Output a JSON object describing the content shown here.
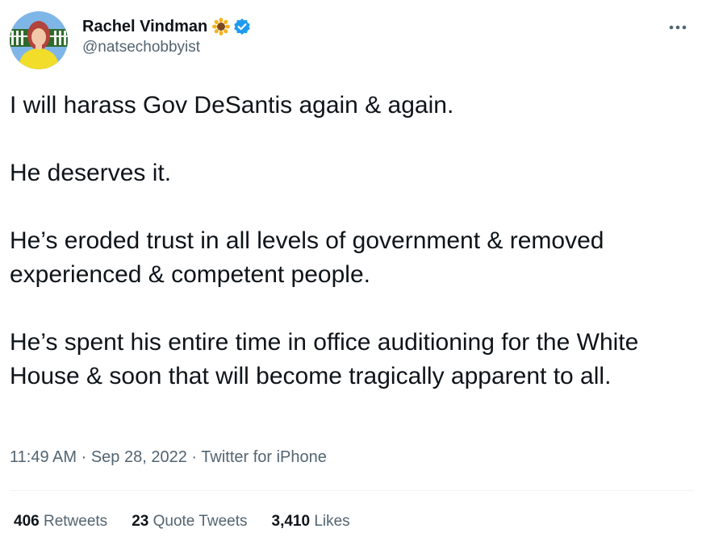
{
  "author": {
    "display_name": "Rachel Vindman",
    "handle": "@natsechobbyist",
    "badge_emoji_icon": "sunflower-icon",
    "verified_icon": "verified-badge-icon",
    "verified_color": "#1d9bf0"
  },
  "tweet": {
    "text": "I will harass Gov DeSantis again & again.\n\nHe deserves it.\n\nHe’s eroded trust in all levels of government & removed experienced & competent people.\n\nHe’s spent his entire time in office auditioning for the White House & soon that will become tragically apparent to all."
  },
  "meta": {
    "time": "11:49 AM",
    "separator": "·",
    "date": "Sep 28, 2022",
    "source": "Twitter for iPhone"
  },
  "stats": {
    "retweets_count": "406",
    "retweets_label": "Retweets",
    "quotes_count": "23",
    "quotes_label": "Quote Tweets",
    "likes_count": "3,410",
    "likes_label": "Likes"
  },
  "colors": {
    "text_primary": "#0f1419",
    "text_secondary": "#536471",
    "divider": "#eff3f4"
  }
}
